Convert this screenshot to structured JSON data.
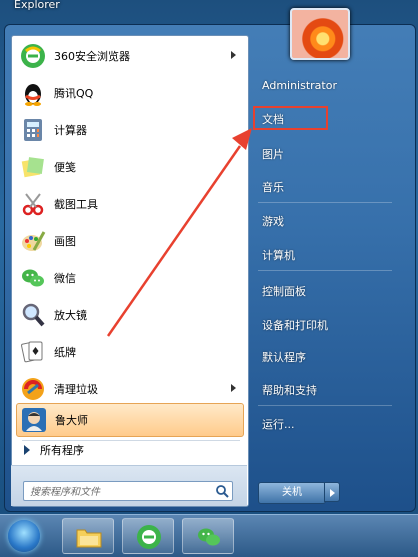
{
  "window": {
    "title": "Explorer"
  },
  "programs": [
    {
      "label": "360安全浏览器",
      "icon": "browser-360-icon",
      "submenu": true
    },
    {
      "label": "腾讯QQ",
      "icon": "qq-penguin-icon",
      "submenu": false
    },
    {
      "label": "计算器",
      "icon": "calculator-icon",
      "submenu": false
    },
    {
      "label": "便笺",
      "icon": "sticky-notes-icon",
      "submenu": false
    },
    {
      "label": "截图工具",
      "icon": "snipping-tool-icon",
      "submenu": false
    },
    {
      "label": "画图",
      "icon": "paint-icon",
      "submenu": false
    },
    {
      "label": "微信",
      "icon": "wechat-icon",
      "submenu": false
    },
    {
      "label": "放大镜",
      "icon": "magnifier-icon",
      "submenu": false
    },
    {
      "label": "纸牌",
      "icon": "solitaire-icon",
      "submenu": false
    },
    {
      "label": "清理垃圾",
      "icon": "cleanup-icon",
      "submenu": true
    },
    {
      "label": "鲁大师",
      "icon": "ludashi-icon",
      "submenu": false,
      "selected": true
    }
  ],
  "all_programs": "所有程序",
  "search": {
    "placeholder": "搜索程序和文件"
  },
  "right_menu": {
    "username": "Administrator",
    "items": [
      "文档",
      "图片",
      "音乐",
      "游戏",
      "计算机",
      "控制面板",
      "设备和打印机",
      "默认程序",
      "帮助和支持",
      "运行..."
    ],
    "highlighted": "文档"
  },
  "shutdown": {
    "label": "关机"
  },
  "colors": {
    "highlight_box": "#e8412f",
    "annotation_arrow": "#e8412f",
    "selected_item": "#ffcb8b"
  }
}
